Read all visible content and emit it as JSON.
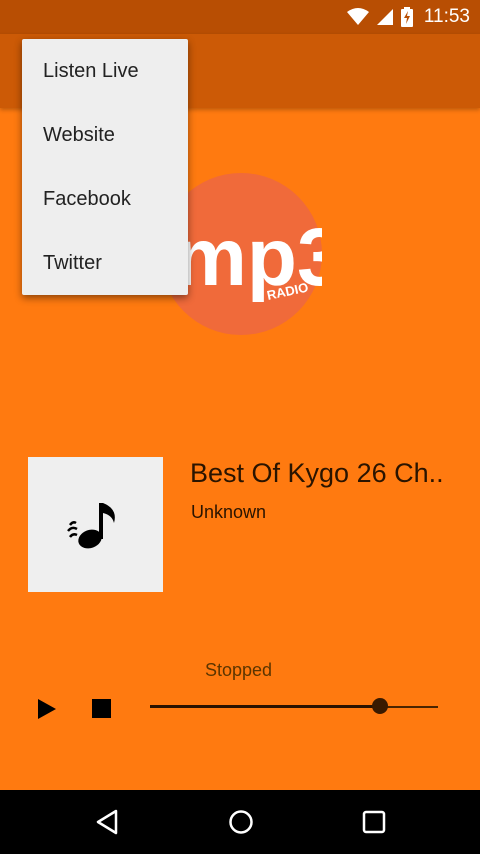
{
  "status_bar": {
    "time": "11:53",
    "icons": [
      "wifi-icon",
      "cell-signal-icon",
      "battery-charging-icon"
    ]
  },
  "logo": {
    "text": "mp3",
    "sub_text": "RADIO",
    "circle_color": "#F06A3A"
  },
  "menu": {
    "items": [
      {
        "label": "Listen Live"
      },
      {
        "label": "Website"
      },
      {
        "label": "Facebook"
      },
      {
        "label": "Twitter"
      }
    ]
  },
  "now_playing": {
    "title": "Best Of Kygo 26 Ch..",
    "artist": "Unknown",
    "art_icon": "music-note-icon"
  },
  "player": {
    "state": "Stopped",
    "progress": 0.8,
    "controls": [
      "play-icon",
      "stop-icon"
    ]
  },
  "nav_bar": {
    "buttons": [
      "back-icon",
      "home-icon",
      "recents-icon"
    ]
  },
  "colors": {
    "background": "#FF7A10",
    "status_bar": "#B84E03",
    "app_bar": "#CC5A06",
    "menu_bg": "#EEEEEE"
  }
}
